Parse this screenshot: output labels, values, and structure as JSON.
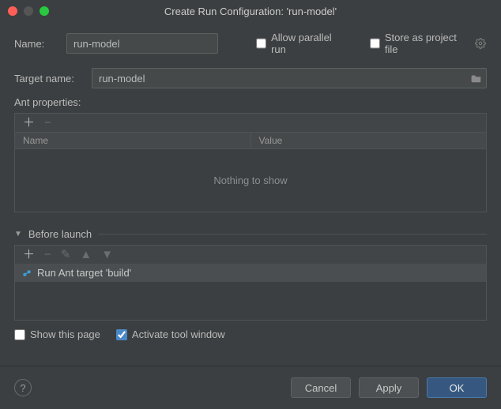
{
  "title": "Create Run Configuration: 'run-model'",
  "name_row": {
    "label": "Name:",
    "value": "run-model",
    "allow_parallel_label": "Allow parallel run",
    "allow_parallel_checked": false,
    "store_as_label": "Store as project file",
    "store_as_checked": false
  },
  "target": {
    "label": "Target name:",
    "value": "run-model"
  },
  "ant_properties": {
    "label": "Ant properties:",
    "columns": {
      "name": "Name",
      "value": "Value"
    },
    "empty_text": "Nothing to show"
  },
  "before_launch": {
    "label": "Before launch",
    "items": [
      {
        "label": "Run Ant target 'build'"
      }
    ]
  },
  "bottom": {
    "show_this_page_label": "Show this page",
    "show_this_page_checked": false,
    "activate_tool_label": "Activate tool window",
    "activate_tool_checked": true
  },
  "footer": {
    "cancel": "Cancel",
    "apply": "Apply",
    "ok": "OK"
  }
}
